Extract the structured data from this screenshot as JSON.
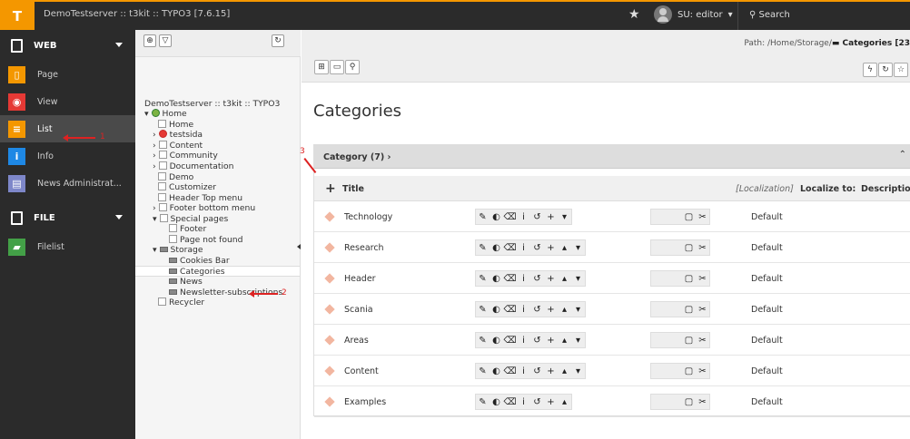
{
  "topbar": {
    "logo": "T",
    "site": "DemoTestserver :: t3kit :: TYPO3 [7.6.15]",
    "user": "SU: editor",
    "user_caret": "▾",
    "search": "Search"
  },
  "modules": {
    "web_group": "WEB",
    "web_items": [
      "Page",
      "View",
      "List",
      "Info",
      "News Administrat..."
    ],
    "file_group": "FILE",
    "file_items": [
      "Filelist"
    ]
  },
  "tree": {
    "root": "DemoTestserver :: t3kit :: TYPO3",
    "nodes": [
      "Home",
      "Home",
      "testsida",
      "Content",
      "Community",
      "Documentation",
      "Demo",
      "Customizer",
      "Header Top menu",
      "Footer bottom menu",
      "Special pages",
      "Footer",
      "Page not found",
      "Storage",
      "Cookies Bar",
      "Categories",
      "News",
      "Newsletter-subscriptions",
      "Recycler"
    ]
  },
  "annotations": {
    "a1": "1",
    "a2": "2",
    "a3": "3"
  },
  "path": {
    "prefix": "Path: /Home/Storage/",
    "current": "Categories [23"
  },
  "page_title": "Categories",
  "table": {
    "header": "Category (7)",
    "header_arrow": "›",
    "col_title": "Title",
    "col_localization": "[Localization]",
    "col_localize_to": "Localize to:",
    "col_description": "Description",
    "rows": [
      {
        "title": "Technology",
        "lang": "Default"
      },
      {
        "title": "Research",
        "lang": "Default"
      },
      {
        "title": "Header",
        "lang": "Default"
      },
      {
        "title": "Scania",
        "lang": "Default"
      },
      {
        "title": "Areas",
        "lang": "Default"
      },
      {
        "title": "Content",
        "lang": "Default"
      },
      {
        "title": "Examples",
        "lang": "Default"
      }
    ]
  }
}
